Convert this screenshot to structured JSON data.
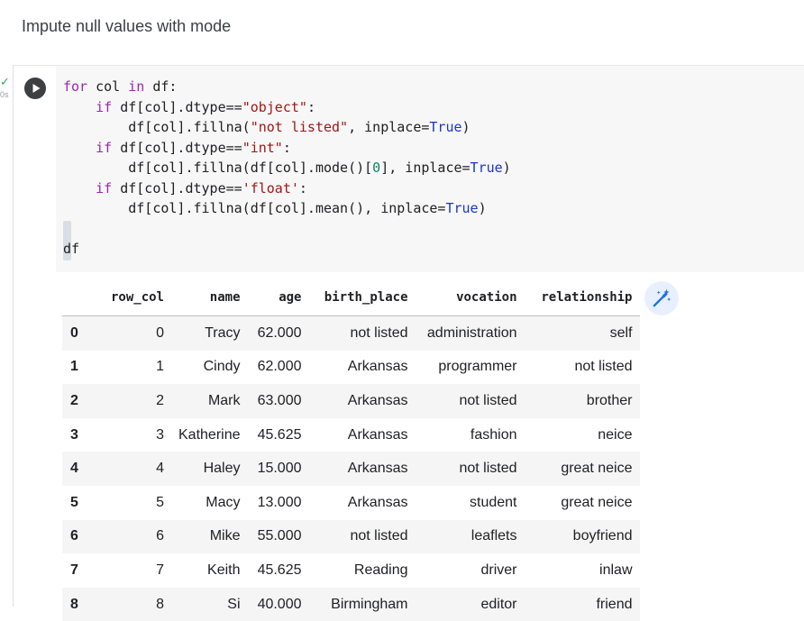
{
  "markdown": {
    "title": "Impute null values with mode"
  },
  "cell": {
    "status_icon": "check-icon",
    "exec_time": "0s",
    "run_icon": "play-icon",
    "code_lines": [
      "for col in df:",
      "    if df[col].dtype==\"object\":",
      "        df[col].fillna(\"not listed\", inplace=True)",
      "    if df[col].dtype==\"int\":",
      "        df[col].fillna(df[col].mode()[0], inplace=True)",
      "    if df[col].dtype=='float':",
      "        df[col].fillna(df[col].mean(), inplace=True)",
      "",
      "df"
    ]
  },
  "output": {
    "columns": [
      "",
      "row_col",
      "name",
      "age",
      "birth_place",
      "vocation",
      "relationship"
    ],
    "rows": [
      {
        "index": "0",
        "row_col": "0",
        "name": "Tracy",
        "age": "62.000",
        "birth_place": "not listed",
        "vocation": "administration",
        "relationship": "self"
      },
      {
        "index": "1",
        "row_col": "1",
        "name": "Cindy",
        "age": "62.000",
        "birth_place": "Arkansas",
        "vocation": "programmer",
        "relationship": "not listed"
      },
      {
        "index": "2",
        "row_col": "2",
        "name": "Mark",
        "age": "63.000",
        "birth_place": "Arkansas",
        "vocation": "not listed",
        "relationship": "brother"
      },
      {
        "index": "3",
        "row_col": "3",
        "name": "Katherine",
        "age": "45.625",
        "birth_place": "Arkansas",
        "vocation": "fashion",
        "relationship": "neice"
      },
      {
        "index": "4",
        "row_col": "4",
        "name": "Haley",
        "age": "15.000",
        "birth_place": "Arkansas",
        "vocation": "not listed",
        "relationship": "great neice"
      },
      {
        "index": "5",
        "row_col": "5",
        "name": "Macy",
        "age": "13.000",
        "birth_place": "Arkansas",
        "vocation": "student",
        "relationship": "great neice"
      },
      {
        "index": "6",
        "row_col": "6",
        "name": "Mike",
        "age": "55.000",
        "birth_place": "not listed",
        "vocation": "leaflets",
        "relationship": "boyfriend"
      },
      {
        "index": "7",
        "row_col": "7",
        "name": "Keith",
        "age": "45.625",
        "birth_place": "Reading",
        "vocation": "driver",
        "relationship": "inlaw"
      },
      {
        "index": "8",
        "row_col": "8",
        "name": "Si",
        "age": "40.000",
        "birth_place": "Birmingham",
        "vocation": "editor",
        "relationship": "friend"
      }
    ],
    "magic_icon": "magic-wand-icon"
  },
  "colors": {
    "run_button": "#3c4043",
    "code_background": "#f7f7f7",
    "keyword": "#9c27b0",
    "string": "#a31515",
    "boolean": "#1a35c9",
    "number": "#098658",
    "magic_button_bg": "#e8f0fe",
    "magic_button_fg": "#1a73e8",
    "check": "#34a853"
  }
}
